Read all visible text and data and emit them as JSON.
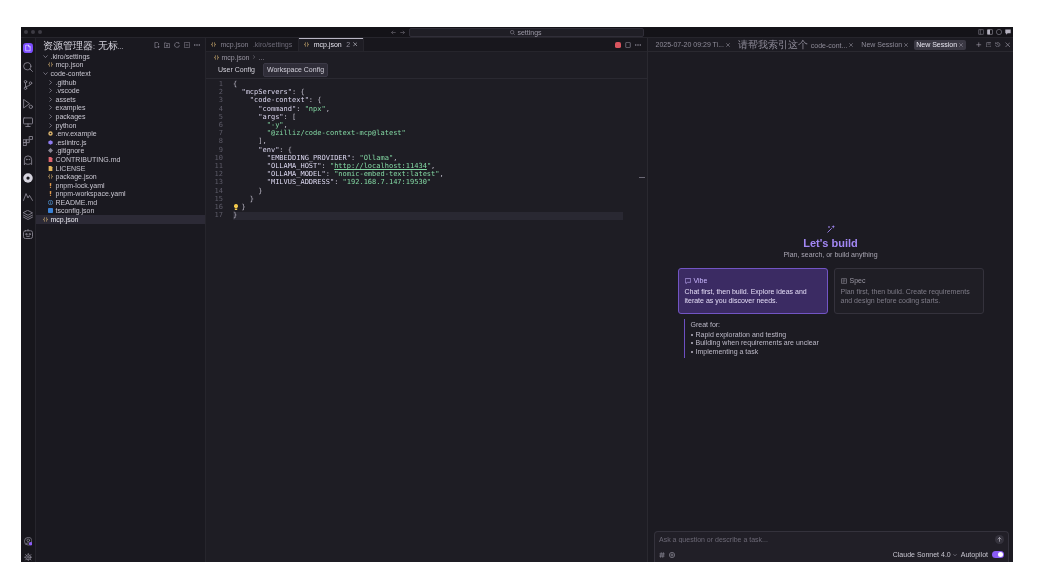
{
  "title_bar": {
    "search": {
      "text": "settings"
    }
  },
  "activity_bar": {
    "items": [
      {
        "kind": "files",
        "selected": true
      },
      {
        "kind": "search",
        "selected": false
      },
      {
        "kind": "branch",
        "selected": false
      },
      {
        "kind": "debug",
        "selected": false
      },
      {
        "kind": "monitor",
        "selected": false
      },
      {
        "kind": "extensions",
        "selected": false
      },
      {
        "kind": "ghost",
        "selected": false
      },
      {
        "kind": "circle",
        "selected": false
      },
      {
        "kind": "zigzag",
        "selected": false
      },
      {
        "kind": "stack",
        "selected": false
      },
      {
        "kind": "robot",
        "selected": false
      }
    ],
    "bottom": [
      {
        "kind": "account",
        "badge": true
      },
      {
        "kind": "gear",
        "badge": false
      }
    ]
  },
  "explorer": {
    "title": "资源管理器: 无标...",
    "tree": [
      {
        "label": ".kiro/settings",
        "kind": "folder",
        "expanded": true,
        "selected": false,
        "children": [
          {
            "label": "mcp.json",
            "kind": "json",
            "selected": false
          }
        ]
      },
      {
        "label": "code-context",
        "kind": "folder",
        "expanded": true,
        "selected": false,
        "children": [
          {
            "label": ".github",
            "kind": "folder",
            "expanded": false,
            "selected": false
          },
          {
            "label": ".vscode",
            "kind": "folder",
            "expanded": false,
            "selected": false
          },
          {
            "label": "assets",
            "kind": "folder",
            "expanded": false,
            "selected": false
          },
          {
            "label": "examples",
            "kind": "folder",
            "expanded": false,
            "selected": false
          },
          {
            "label": "packages",
            "kind": "folder",
            "expanded": false,
            "selected": false
          },
          {
            "label": "python",
            "kind": "folder",
            "expanded": false,
            "selected": false
          },
          {
            "label": ".env.example",
            "kind": "env",
            "selected": false
          },
          {
            "label": ".eslintrc.js",
            "kind": "eslint",
            "selected": false
          },
          {
            "label": ".gitignore",
            "kind": "git",
            "selected": false
          },
          {
            "label": "CONTRIBUTING.md",
            "kind": "markdown",
            "selected": false
          },
          {
            "label": "LICENSE",
            "kind": "license",
            "selected": false
          },
          {
            "label": "package.json",
            "kind": "json",
            "selected": false
          },
          {
            "label": "pnpm-lock.yaml",
            "kind": "yaml",
            "selected": false
          },
          {
            "label": "pnpm-workspace.yaml",
            "kind": "yaml",
            "selected": false
          },
          {
            "label": "README.md",
            "kind": "info",
            "selected": false
          },
          {
            "label": "tsconfig.json",
            "kind": "tsconfig",
            "selected": false
          }
        ]
      },
      {
        "label": "mcp.json",
        "kind": "json",
        "selected": true
      }
    ]
  },
  "editor": {
    "tabs": [
      {
        "kind": "json",
        "label": "mcp.json",
        "description": ".kiro/settings",
        "selected": false
      },
      {
        "kind": "json",
        "label": "mcp.json",
        "badge": "2",
        "selected": true
      }
    ],
    "breadcrumb": [
      {
        "kind": "json",
        "label": "mcp.json"
      },
      {
        "label": "..."
      }
    ],
    "config_tabs": [
      {
        "label": "User Config",
        "selected": false
      },
      {
        "label": "Workspace Config",
        "selected": true
      }
    ],
    "code": [
      {
        "number": "1",
        "tokens": [
          {
            "kind": "punct",
            "text": "{"
          }
        ],
        "current": false,
        "lightbulb": false
      },
      {
        "number": "2",
        "tokens": [
          {
            "kind": "key",
            "text": "  \"mcpServers\""
          },
          {
            "kind": "punct",
            "text": ": {"
          }
        ],
        "current": false,
        "lightbulb": false
      },
      {
        "number": "3",
        "tokens": [
          {
            "kind": "key",
            "text": "    \"code-context\""
          },
          {
            "kind": "punct",
            "text": ": {"
          }
        ],
        "current": false,
        "lightbulb": false
      },
      {
        "number": "4",
        "tokens": [
          {
            "kind": "key",
            "text": "      \"command\""
          },
          {
            "kind": "punct",
            "text": ": "
          },
          {
            "kind": "string",
            "text": "\"npx\""
          },
          {
            "kind": "punct",
            "text": ","
          }
        ],
        "current": false,
        "lightbulb": false
      },
      {
        "number": "5",
        "tokens": [
          {
            "kind": "key",
            "text": "      \"args\""
          },
          {
            "kind": "punct",
            "text": ": ["
          }
        ],
        "current": false,
        "lightbulb": false
      },
      {
        "number": "6",
        "tokens": [
          {
            "kind": "string",
            "text": "        \"-y\""
          },
          {
            "kind": "punct",
            "text": ","
          }
        ],
        "current": false,
        "lightbulb": false
      },
      {
        "number": "7",
        "tokens": [
          {
            "kind": "string",
            "text": "        \"@zilliz/code-context-mcp@latest\""
          }
        ],
        "current": false,
        "lightbulb": false
      },
      {
        "number": "8",
        "tokens": [
          {
            "kind": "punct",
            "text": "      ],"
          }
        ],
        "current": false,
        "lightbulb": false
      },
      {
        "number": "9",
        "tokens": [
          {
            "kind": "key",
            "text": "      \"env\""
          },
          {
            "kind": "punct",
            "text": ": {"
          }
        ],
        "current": false,
        "lightbulb": false
      },
      {
        "number": "10",
        "tokens": [
          {
            "kind": "key",
            "text": "        \"EMBEDDING_PROVIDER\""
          },
          {
            "kind": "punct",
            "text": ": "
          },
          {
            "kind": "string",
            "text": "\"Ollama\""
          },
          {
            "kind": "punct",
            "text": ","
          }
        ],
        "current": false,
        "lightbulb": false
      },
      {
        "number": "11",
        "tokens": [
          {
            "kind": "key",
            "text": "        \"OLLAMA_HOST\""
          },
          {
            "kind": "punct",
            "text": ": "
          },
          {
            "kind": "string",
            "text": "\""
          },
          {
            "kind": "link",
            "text": "http://localhost:11434"
          },
          {
            "kind": "string",
            "text": "\""
          },
          {
            "kind": "punct",
            "text": ","
          }
        ],
        "current": false,
        "lightbulb": false
      },
      {
        "number": "12",
        "tokens": [
          {
            "kind": "key",
            "text": "        \"OLLAMA_MODEL\""
          },
          {
            "kind": "punct",
            "text": ": "
          },
          {
            "kind": "string",
            "text": "\"nomic-embed-text:latest\""
          },
          {
            "kind": "punct",
            "text": ","
          }
        ],
        "current": false,
        "lightbulb": false
      },
      {
        "number": "13",
        "tokens": [
          {
            "kind": "key",
            "text": "        \"MILVUS_ADDRESS\""
          },
          {
            "kind": "punct",
            "text": ": "
          },
          {
            "kind": "string",
            "text": "\"192.168.7.147:19530\""
          }
        ],
        "current": false,
        "lightbulb": false
      },
      {
        "number": "14",
        "tokens": [
          {
            "kind": "punct",
            "text": "      }"
          }
        ],
        "current": false,
        "lightbulb": false
      },
      {
        "number": "15",
        "tokens": [
          {
            "kind": "punct",
            "text": "    }"
          }
        ],
        "current": false,
        "lightbulb": false
      },
      {
        "number": "16",
        "tokens": [
          {
            "kind": "punct",
            "text": "  }"
          }
        ],
        "current": false,
        "lightbulb": true
      },
      {
        "number": "17",
        "tokens": [
          {
            "kind": "punct",
            "text": "}"
          }
        ],
        "current": true,
        "lightbulb": false
      }
    ]
  },
  "agent_panel": {
    "sessions": [
      {
        "label": "2025-07-20 09:29 Ti...",
        "selected": false
      },
      {
        "label": "请帮我索引这个 code-cont...",
        "selected": false
      },
      {
        "label": "New Session",
        "selected": false
      },
      {
        "label": "New Session",
        "selected": true
      }
    ],
    "hero": {
      "title": "Let's build",
      "subtitle": "Plan, search, or build anything"
    },
    "modes": [
      {
        "kind": "chat",
        "name": "Vibe",
        "description": "Chat first, then build. Explore ideas and iterate as you discover needs.",
        "selected": true
      },
      {
        "kind": "document",
        "name": "Spec",
        "description": "Plan first, then build. Create requirements and design before coding starts.",
        "selected": false
      }
    ],
    "great_for": {
      "title": "Great for:",
      "items": [
        "Rapid exploration and testing",
        "Building when requirements are unclear",
        "Implementing a task"
      ]
    },
    "chat": {
      "placeholder": "Ask a question or describe a task...",
      "model": "Claude Sonnet 4.0",
      "autopilot": {
        "label": "Autopilot",
        "on": true
      }
    }
  }
}
